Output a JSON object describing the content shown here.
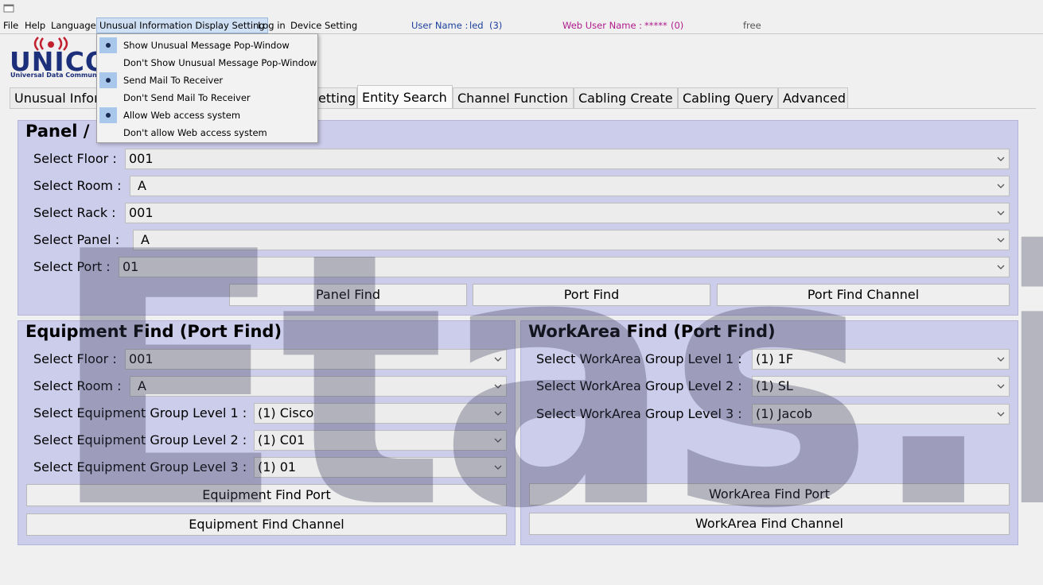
{
  "menubar": {
    "items": [
      "File",
      "Help",
      "Language",
      "Unusual Information Display Setting",
      "Log in",
      "Device Setting"
    ]
  },
  "status": {
    "user_label": "User Name :",
    "user_value": "led",
    "user_count": "(3)",
    "web_user_label": "Web User Name :",
    "web_user_value": "*****",
    "web_user_count": "(0)",
    "free": "free"
  },
  "popup": {
    "items": [
      {
        "label": "Show Unusual Message Pop-Window",
        "checked": true
      },
      {
        "label": "Don't Show Unusual Message Pop-Window",
        "checked": false
      },
      {
        "label": "Send Mail To Receiver",
        "checked": true
      },
      {
        "label": "Don't Send Mail To Receiver",
        "checked": false
      },
      {
        "label": "Allow Web access system",
        "checked": true
      },
      {
        "label": "Don't allow Web access system",
        "checked": false
      }
    ]
  },
  "logo": {
    "text": "UNICOM",
    "subtitle": "Universal Data Communica"
  },
  "tabs": [
    {
      "label": "Unusual Infor"
    },
    {
      "label": "etting"
    },
    {
      "label": "Entity Search"
    },
    {
      "label": "Channel Function"
    },
    {
      "label": "Cabling Create"
    },
    {
      "label": "Cabling Query"
    },
    {
      "label": "Advanced"
    }
  ],
  "panel_find": {
    "title": "Panel / I",
    "floor_label": "Select Floor :",
    "floor_value": "001",
    "room_label": "Select Room :",
    "room_value": "A",
    "rack_label": "Select Rack :",
    "rack_value": "001",
    "panel_label": "Select Panel :",
    "panel_value": "A",
    "port_label": "Select Port :",
    "port_value": "01",
    "btn_panel_find": "Panel Find",
    "btn_port_find": "Port Find",
    "btn_port_find_channel": "Port Find Channel"
  },
  "equipment_find": {
    "title": "Equipment Find (Port Find)",
    "floor_label": "Select Floor :",
    "floor_value": "001",
    "room_label": "Select Room :",
    "room_value": "A",
    "g1_label": "Select Equipment Group Level 1 :",
    "g1_value": "(1) Cisco",
    "g2_label": "Select Equipment Group Level 2 :",
    "g2_value": "(1) C01",
    "g3_label": "Select Equipment Group Level 3 :",
    "g3_value": "(1) 01",
    "btn_port": "Equipment Find Port",
    "btn_channel": "Equipment Find Channel"
  },
  "workarea_find": {
    "title": "WorkArea Find (Port Find)",
    "g1_label": "Select WorkArea Group Level 1 :",
    "g1_value": "(1) 1F",
    "g2_label": "Select WorkArea Group Level 2 :",
    "g2_value": "(1) SL",
    "g3_label": "Select WorkArea Group Level 3 :",
    "g3_value": "(1) Jacob",
    "btn_port": "WorkArea Find Port",
    "btn_channel": "WorkArea Find Channel"
  },
  "watermark": {
    "text": "Etas.ir"
  },
  "icons": {
    "combo_arrow": "chevron-down-icon",
    "radio": "radio-dot-icon",
    "app": "java-window-icon"
  }
}
